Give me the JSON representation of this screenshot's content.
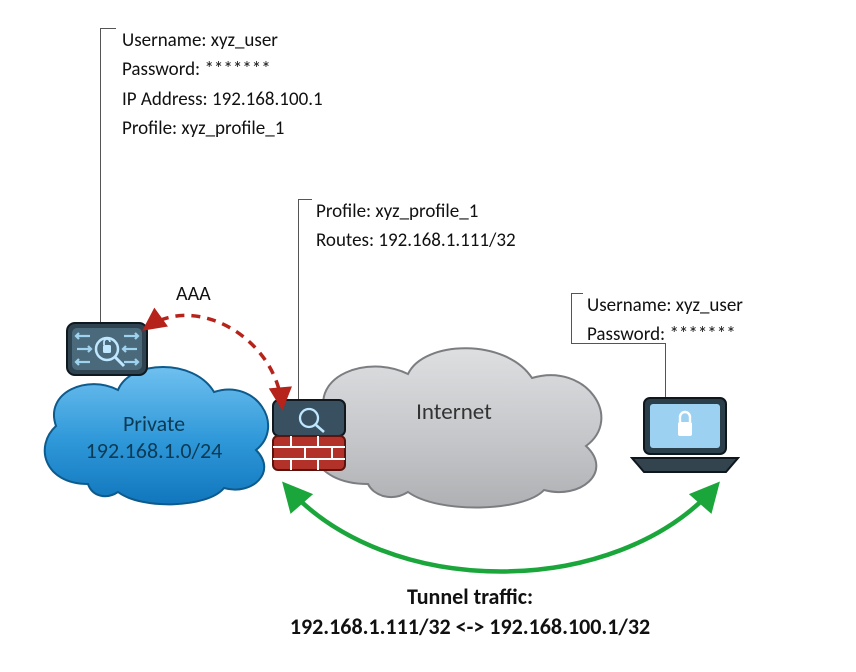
{
  "server_callout": {
    "user_lbl": "Username:",
    "user_val": "xyz_user",
    "pass_lbl": "Password:",
    "pass_val": "*******",
    "ip_lbl": "IP Address:",
    "ip_val": "192.168.100.1",
    "prof_lbl": "Profile:",
    "prof_val": "xyz_profile_1"
  },
  "firewall_callout": {
    "prof_lbl": "Profile:",
    "prof_val": "xyz_profile_1",
    "routes_lbl": "Routes:",
    "routes_val": "192.168.1.111/32"
  },
  "laptop_callout": {
    "user_lbl": "Username:",
    "user_val": "xyz_user",
    "pass_lbl": "Password:",
    "pass_val": "*******"
  },
  "clouds": {
    "private_l1": "Private",
    "private_l2": "192.168.1.0/24",
    "internet": "Internet"
  },
  "aaa": "AAA",
  "tunnel": {
    "title": "Tunnel traffic:",
    "route": "192.168.1.111/32 <-> 192.168.100.1/32"
  }
}
